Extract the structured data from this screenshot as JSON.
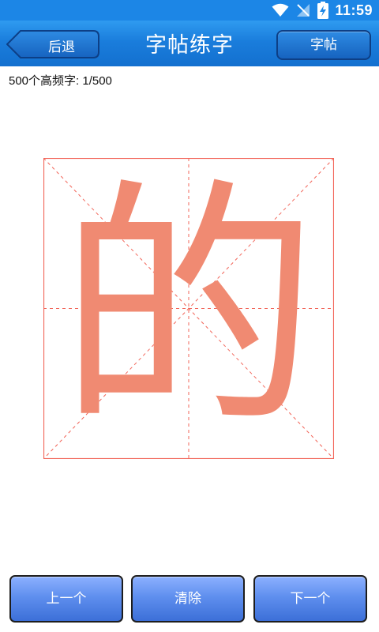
{
  "status_bar": {
    "time": "11:59",
    "icons": [
      "wifi-icon",
      "no-signal-icon",
      "battery-charging-icon"
    ]
  },
  "header": {
    "back_label": "后退",
    "title": "字帖练字",
    "right_label": "字帖"
  },
  "progress": {
    "text": "500个高频字: 1/500"
  },
  "practice": {
    "character": "的",
    "character_color": "#f08a72",
    "grid_color": "#f2665a"
  },
  "buttons": {
    "prev_label": "上一个",
    "clear_label": "清除",
    "next_label": "下一个"
  },
  "colors": {
    "header_blue": "#1a7ddc",
    "button_blue": "#5f8fee"
  }
}
